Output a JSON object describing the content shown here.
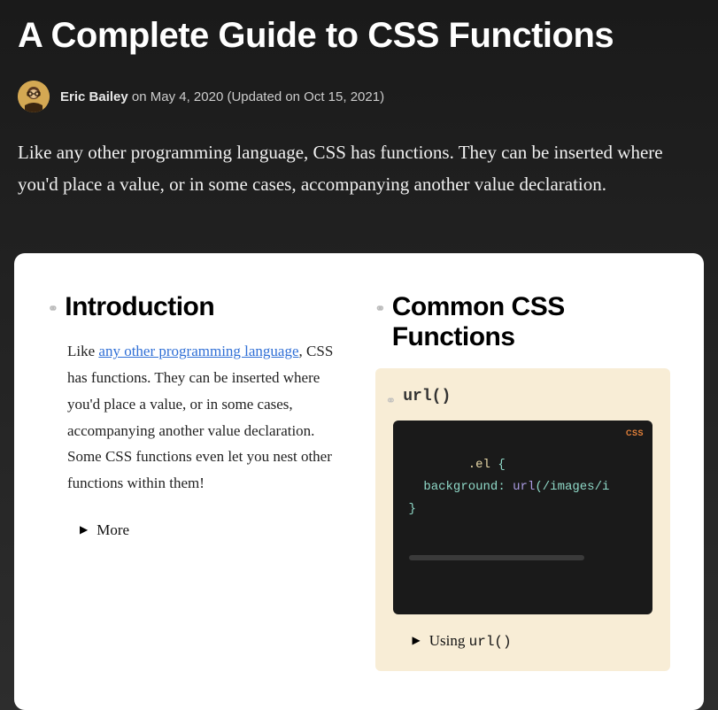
{
  "header": {
    "title": "A Complete Guide to CSS Functions",
    "author": "Eric Bailey",
    "byline_middle": " on May 4, 2020 (Updated on Oct 15, 2021)",
    "intro": "Like any other programming language, CSS has functions. They can be inserted where you'd place a value, or in some cases, accompanying another value declaration."
  },
  "left": {
    "heading": "Introduction",
    "body_pre": "Like ",
    "body_link": "any other programming language",
    "body_post": ", CSS has functions. They can be inserted where you'd place a value, or in some cases, accompanying another value declaration. Some CSS functions even let you nest other functions within them!",
    "more_label": "More"
  },
  "right": {
    "heading": "Common CSS Functions",
    "func_name": "url()",
    "code_lang": "CSS",
    "code": {
      "selector": ".el",
      "brace_open": " {",
      "prop_indent": "  ",
      "prop": "background",
      "colon": ": ",
      "func": "url",
      "paren_open": "(",
      "arg": "/images/i",
      "brace_close": "}"
    },
    "using_pre": "Using ",
    "using_code": "url()"
  }
}
